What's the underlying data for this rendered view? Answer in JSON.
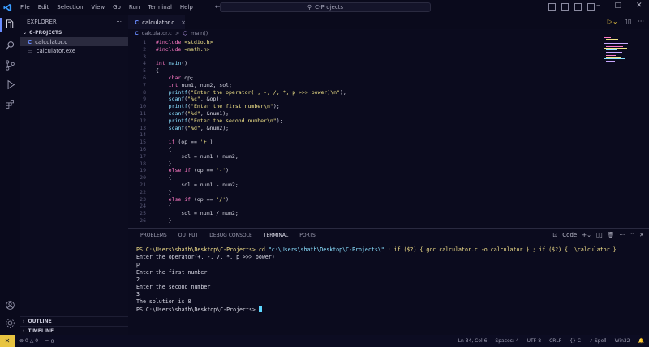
{
  "menu": [
    "File",
    "Edit",
    "Selection",
    "View",
    "Go",
    "Run",
    "Terminal",
    "Help"
  ],
  "search": {
    "text": "C-Projects"
  },
  "sidebar": {
    "header": "EXPLORER",
    "more": "···",
    "project": "C-PROJECTS",
    "files": [
      {
        "name": "calculator.c",
        "selected": true
      },
      {
        "name": "calculator.exe",
        "selected": false
      }
    ],
    "outline": "OUTLINE",
    "timeline": "TIMELINE"
  },
  "tab": {
    "label": "calculator.c",
    "close": "×"
  },
  "breadcrumb": {
    "file": "calculator.c",
    "sep": ">",
    "symbol": "main()"
  },
  "code": [
    {
      "n": "1",
      "t": "#include <stdio.h>"
    },
    {
      "n": "2",
      "t": "#include <math.h>"
    },
    {
      "n": "3",
      "t": ""
    },
    {
      "n": "4",
      "t": "int main()"
    },
    {
      "n": "5",
      "t": "{"
    },
    {
      "n": "6",
      "t": "    char op;"
    },
    {
      "n": "7",
      "t": "    int num1, num2, sol;"
    },
    {
      "n": "8",
      "t": "    printf(\"Enter the operator(+, -, /, *, p >>> power)\\n\");"
    },
    {
      "n": "9",
      "t": "    scanf(\"%c\", &op);"
    },
    {
      "n": "10",
      "t": "    printf(\"Enter the first number\\n\");"
    },
    {
      "n": "11",
      "t": "    scanf(\"%d\", &num1);"
    },
    {
      "n": "12",
      "t": "    printf(\"Enter the second number\\n\");"
    },
    {
      "n": "13",
      "t": "    scanf(\"%d\", &num2);"
    },
    {
      "n": "14",
      "t": ""
    },
    {
      "n": "15",
      "t": "    if (op == '+')"
    },
    {
      "n": "16",
      "t": "    {"
    },
    {
      "n": "17",
      "t": "        sol = num1 + num2;"
    },
    {
      "n": "18",
      "t": "    }"
    },
    {
      "n": "19",
      "t": "    else if (op == '-')"
    },
    {
      "n": "20",
      "t": "    {"
    },
    {
      "n": "21",
      "t": "        sol = num1 - num2;"
    },
    {
      "n": "22",
      "t": "    }"
    },
    {
      "n": "23",
      "t": "    else if (op == '/')"
    },
    {
      "n": "24",
      "t": "    {"
    },
    {
      "n": "25",
      "t": "        sol = num1 / num2;"
    },
    {
      "n": "26",
      "t": "    }"
    }
  ],
  "panel": {
    "tabs": [
      "PROBLEMS",
      "OUTPUT",
      "DEBUG CONSOLE",
      "TERMINAL",
      "PORTS"
    ],
    "active": "TERMINAL",
    "shell": "Code",
    "terminal": [
      {
        "cls": "cmdline",
        "t": ""
      },
      {
        "cls": "out",
        "t": "Enter the operator(+, -, /, *, p >>> power)"
      },
      {
        "cls": "out",
        "t": "p"
      },
      {
        "cls": "out",
        "t": "Enter the first number"
      },
      {
        "cls": "out",
        "t": "2"
      },
      {
        "cls": "out",
        "t": "Enter the second number"
      },
      {
        "cls": "out",
        "t": "3"
      },
      {
        "cls": "out",
        "t": "The solution is 8"
      }
    ],
    "prompt": "PS C:\\Users\\shath\\Desktop\\C-Projects>",
    "command": "cd",
    "command_arg": "\"c:\\Users\\shath\\Desktop\\C-Projects\\\"",
    "command_rest": " ; if ($?) { gcc calculator.c -o calculator } ; if ($?) { .\\calculator }",
    "final_prompt": "PS C:\\Users\\shath\\Desktop\\C-Projects>"
  },
  "status": {
    "errors": "0",
    "warnings": "0",
    "ports": "0",
    "position": "Ln 34, Col 6",
    "spaces": "Spaces: 4",
    "encoding": "UTF-8",
    "eol": "CRLF",
    "language": "C",
    "spell": "Spell",
    "platform": "Win32"
  }
}
